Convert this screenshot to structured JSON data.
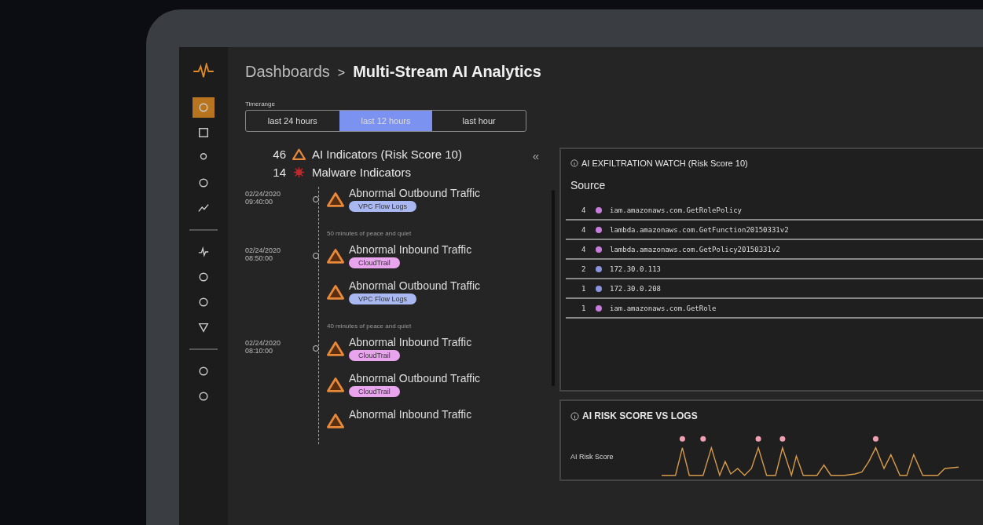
{
  "sidebar": {
    "groups": [
      [
        {
          "selected": true
        },
        {
          "selected": false
        },
        {
          "selected": false
        },
        {
          "selected": false
        },
        {
          "selected": false
        }
      ],
      [
        {
          "selected": false
        },
        {
          "selected": false
        },
        {
          "selected": false
        },
        {
          "selected": false
        }
      ],
      [
        {
          "selected": false
        },
        {
          "selected": false
        }
      ]
    ]
  },
  "breadcrumb": {
    "parent": "Dashboards",
    "separator": ">",
    "current": "Multi-Stream AI Analytics"
  },
  "timerange": {
    "label": "Timerange",
    "options": [
      {
        "label": "last 24 hours",
        "selected": false
      },
      {
        "label": "last 12 hours",
        "selected": true
      },
      {
        "label": "last hour",
        "selected": false
      }
    ]
  },
  "indicators": [
    {
      "kind": "ai",
      "count": "46",
      "label": "AI Indicators (Risk Score 10)"
    },
    {
      "kind": "malware",
      "count": "14",
      "label": "Malware Indicators"
    }
  ],
  "collapse": "«",
  "timeline": [
    {
      "kind": "event",
      "date": "02/24/2020",
      "time": "09:40:00",
      "title": "Abnormal Outbound Traffic",
      "tag": "VPC Flow Logs",
      "color": "#a9b8f0"
    },
    {
      "kind": "gap",
      "text": "50 minutes of peace and quiet"
    },
    {
      "kind": "event",
      "date": "02/24/2020",
      "time": "08:50:00",
      "title": "Abnormal Inbound Traffic",
      "tag": "CloudTrail",
      "color": "#e9a4ee"
    },
    {
      "kind": "event",
      "title": "Abnormal Outbound Traffic",
      "tag": "VPC Flow Logs",
      "color": "#a9b8f0"
    },
    {
      "kind": "gap",
      "text": "40 minutes of peace and quiet"
    },
    {
      "kind": "event",
      "date": "02/24/2020",
      "time": "08:10:00",
      "title": "Abnormal Inbound Traffic",
      "tag": "CloudTrail",
      "color": "#e9a4ee"
    },
    {
      "kind": "event",
      "title": "Abnormal Outbound Traffic",
      "tag": "CloudTrail",
      "color": "#e9a4ee"
    },
    {
      "kind": "event",
      "title": "Abnormal Inbound Traffic"
    }
  ],
  "exfiltration": {
    "title": "AI EXFILTRATION WATCH (Risk Score 10)",
    "heading": "Source",
    "rows": [
      {
        "count": "4",
        "name": "iam.amazonaws.com.GetRolePolicy",
        "color": "#c77ddb"
      },
      {
        "count": "4",
        "name": "lambda.amazonaws.com.GetFunction20150331v2",
        "color": "#c77ddb"
      },
      {
        "count": "4",
        "name": "lambda.amazonaws.com.GetPolicy20150331v2",
        "color": "#c77ddb"
      },
      {
        "count": "2",
        "name": "172.30.0.113",
        "color": "#8b93dd"
      },
      {
        "count": "1",
        "name": "172.30.0.208",
        "color": "#8b93dd"
      },
      {
        "count": "1",
        "name": "iam.amazonaws.com.GetRole",
        "color": "#c77ddb"
      }
    ]
  },
  "risk_chart": {
    "title": "AI RISK SCORE VS LOGS",
    "row_label": "AI Risk Score"
  }
}
